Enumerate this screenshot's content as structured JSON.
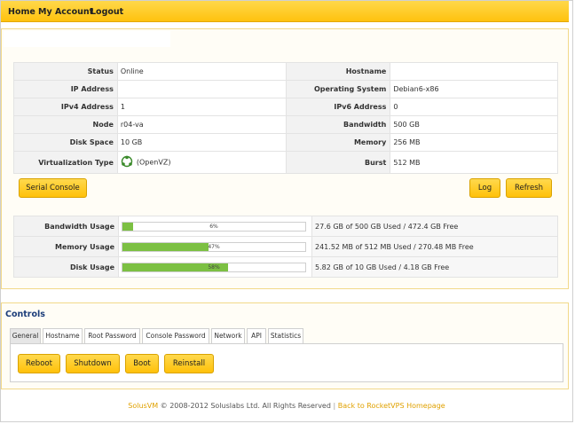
{
  "nav": {
    "home": "Home",
    "account": "My Account",
    "logout": "Logout"
  },
  "info": {
    "status_label": "Status",
    "status_value": "Online",
    "hostname_label": "Hostname",
    "hostname_value": "",
    "ip_label": "IP Address",
    "ip_value": "",
    "os_label": "Operating System",
    "os_value": "Debian6-x86",
    "ipv4_label": "IPv4 Address",
    "ipv4_value": "1",
    "ipv6_label": "IPv6 Address",
    "ipv6_value": "0",
    "node_label": "Node",
    "node_value": "r04-va",
    "bandwidth_label": "Bandwidth",
    "bandwidth_value": "500 GB",
    "disk_label": "Disk Space",
    "disk_value": "10 GB",
    "memory_label": "Memory",
    "memory_value": "256 MB",
    "virt_label": "Virtualization Type",
    "virt_value": "(OpenVZ)",
    "burst_label": "Burst",
    "burst_value": "512 MB"
  },
  "actions": {
    "serial": "Serial Console",
    "log": "Log",
    "refresh": "Refresh"
  },
  "usage": [
    {
      "label": "Bandwidth Usage",
      "percent": 6,
      "percent_text": "6%",
      "detail": "27.6 GB of 500 GB Used / 472.4 GB Free"
    },
    {
      "label": "Memory Usage",
      "percent": 47,
      "percent_text": "47%",
      "detail": "241.52 MB of 512 MB Used / 270.48 MB Free"
    },
    {
      "label": "Disk Usage",
      "percent": 58,
      "percent_text": "58%",
      "detail": "5.82 GB of 10 GB Used / 4.18 GB Free"
    }
  ],
  "controls": {
    "title": "Controls",
    "tabs": [
      "General",
      "Hostname",
      "Root Password",
      "Console Password",
      "Network",
      "API",
      "Statistics"
    ],
    "buttons": [
      "Reboot",
      "Shutdown",
      "Boot",
      "Reinstall"
    ]
  },
  "footer": {
    "brand": "SolusVM",
    "copyright": "© 2008-2012 Soluslabs Ltd. All Rights Reserved",
    "separator": "|",
    "link": "Back to RocketVPS Homepage"
  },
  "colors": {
    "accent": "#ffc20e",
    "bar_fill": "#7cc043",
    "online": "#2e9a1e",
    "title": "#1b3d7a"
  },
  "icons": {
    "os": "openvz-icon"
  }
}
